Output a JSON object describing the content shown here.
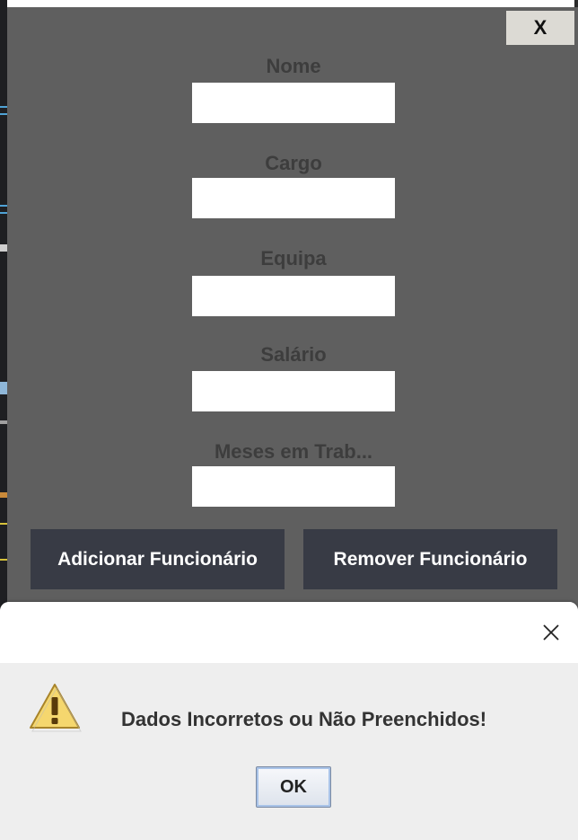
{
  "main_window": {
    "close_label": "X",
    "fields": [
      {
        "label": "Nome",
        "value": ""
      },
      {
        "label": "Cargo",
        "value": ""
      },
      {
        "label": "Equipa",
        "value": ""
      },
      {
        "label": "Salário",
        "value": ""
      },
      {
        "label": "Meses em Trab...",
        "value": ""
      }
    ],
    "buttons": {
      "add_label": "Adicionar Funcionário",
      "remove_label": "Remover Funcionário"
    }
  },
  "dialog": {
    "message": "Dados Incorretos ou Não Preenchidos!",
    "ok_label": "OK",
    "icon": "warning-icon",
    "close_icon": "close-icon"
  },
  "colors": {
    "window_bg": "#5f5f5f",
    "button_bg": "#383b45",
    "dialog_bg": "#eeeeee",
    "warning_fill": "#f5d76e"
  }
}
